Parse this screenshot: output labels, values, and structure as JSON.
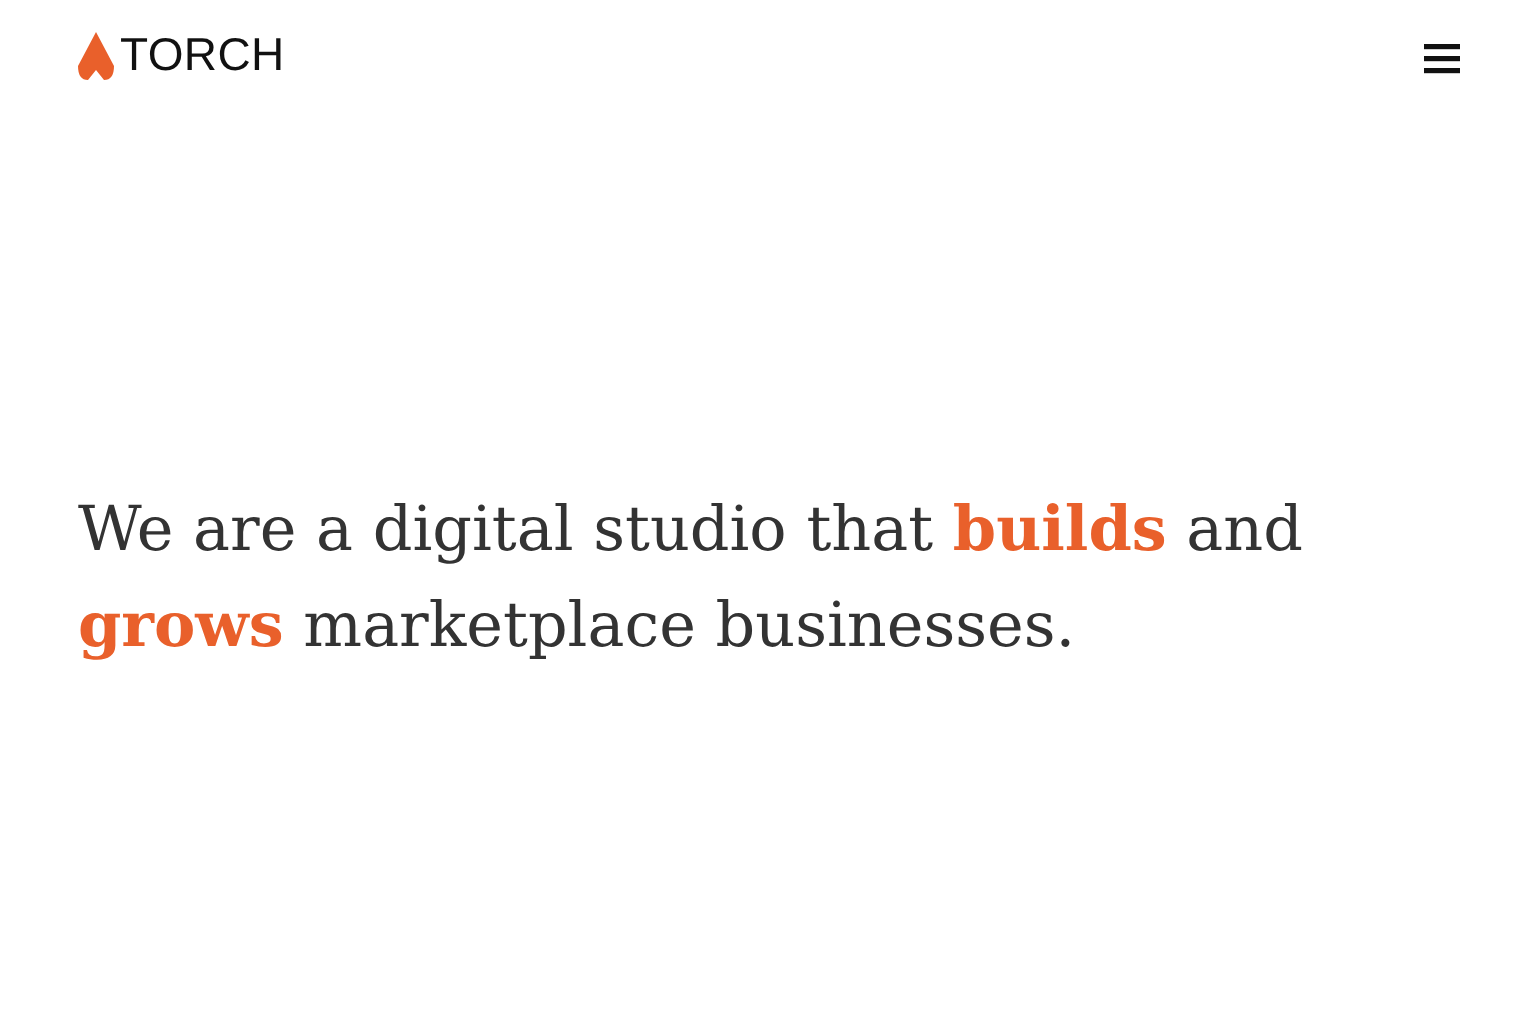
{
  "header": {
    "logo_text": "TORCH"
  },
  "hero": {
    "headline": "We are a digital studio that **builds** and **grows** marketplace businesses."
  }
}
